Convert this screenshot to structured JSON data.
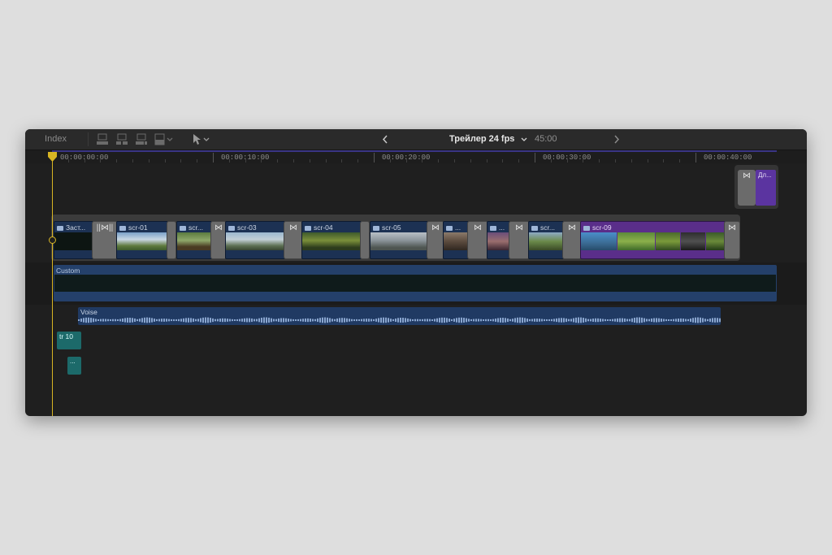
{
  "toolbar": {
    "index_label": "Index",
    "project_title": "Трейлер 24 fps",
    "duration": "45:00",
    "prev_icon": "chevron-left-icon",
    "next_icon": "chevron-right-icon"
  },
  "ruler": {
    "labels": [
      "00:00:00:00",
      "00:00:10:00",
      "00:00:20:00",
      "00:00:30:00",
      "00:00:40:00"
    ]
  },
  "storyline": {
    "clips": [
      {
        "label": "Заст..."
      },
      {
        "label": "scr-01"
      },
      {
        "label": "scr..."
      },
      {
        "label": "scr-03"
      },
      {
        "label": "scr-04"
      },
      {
        "label": "scr-05"
      },
      {
        "label": "..."
      },
      {
        "label": "..."
      },
      {
        "label": "scr..."
      },
      {
        "label": "scr-09"
      }
    ]
  },
  "connected": {
    "top_clip_label": "Дл..."
  },
  "audio": {
    "custom_label": "Custom",
    "voise_label": "Voise",
    "tr10_label": "tr 10",
    "small_label": "..."
  },
  "colors": {
    "playhead": "#d8b523",
    "clip_blue": "#1c3153",
    "clip_purple": "#5a2e8a",
    "audio_teal": "#1c6a6a"
  }
}
